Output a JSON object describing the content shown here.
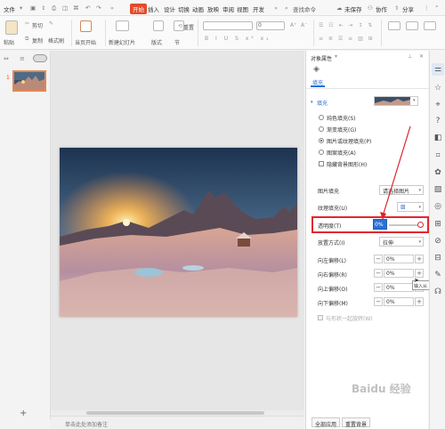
{
  "menubar": {
    "file": "文件",
    "items": [
      "开始",
      "插入",
      "设计",
      "切换",
      "动画",
      "放映",
      "审阅",
      "视图",
      "开发"
    ],
    "active_index": 0,
    "search": "查找命令",
    "unsaved": "未保存",
    "collab": "协作",
    "share": "分享"
  },
  "toolbar": {
    "paste": "粘贴",
    "cut": "剪切",
    "copy": "复制",
    "format_painter": "格式刷",
    "play_from_current": "当页开始",
    "new_slide": "新建幻灯片",
    "layout": "版式",
    "section": "节",
    "reset": "重置",
    "font_size": "0"
  },
  "thumbstrip": {
    "slide_number": "1"
  },
  "panel": {
    "title": "对象属性",
    "tab_fill": "填充",
    "section_fill": "填充",
    "options": [
      "纯色填充(S)",
      "渐变填充(G)",
      "图片或纹理填充(P)",
      "图案填充(A)"
    ],
    "selected_option": 2,
    "hide_bg": "隐藏背景图形(H)",
    "picture_fill_label": "图片填充",
    "picture_fill_value": "请选择图片",
    "texture_fill_label": "纹理填充(U)",
    "transparency_label": "透明度(T)",
    "transparency_value": "0%",
    "placement_label": "放置方式(I)",
    "placement_value": "拉伸",
    "offsets": [
      {
        "label": "向左偏移(L)",
        "value": "0%"
      },
      {
        "label": "向右偏移(R)",
        "value": "0%"
      },
      {
        "label": "向上偏移(O)",
        "value": "0%"
      },
      {
        "label": "向下偏移(M)",
        "value": "0%"
      }
    ],
    "rotate_with_shape": "与形状一起旋转(W)",
    "apply_all": "全部应用",
    "reset_bg": "重置背景",
    "tooltip": "输入从 -1"
  },
  "status": {
    "notes": "单击此处添加备注"
  },
  "watermark": "Baidu 经验",
  "colors": {
    "accent": "#e34b2a",
    "highlight_box": "#e0282e",
    "arrow": "#d9232a",
    "tab_blue": "#2b6fd6"
  }
}
